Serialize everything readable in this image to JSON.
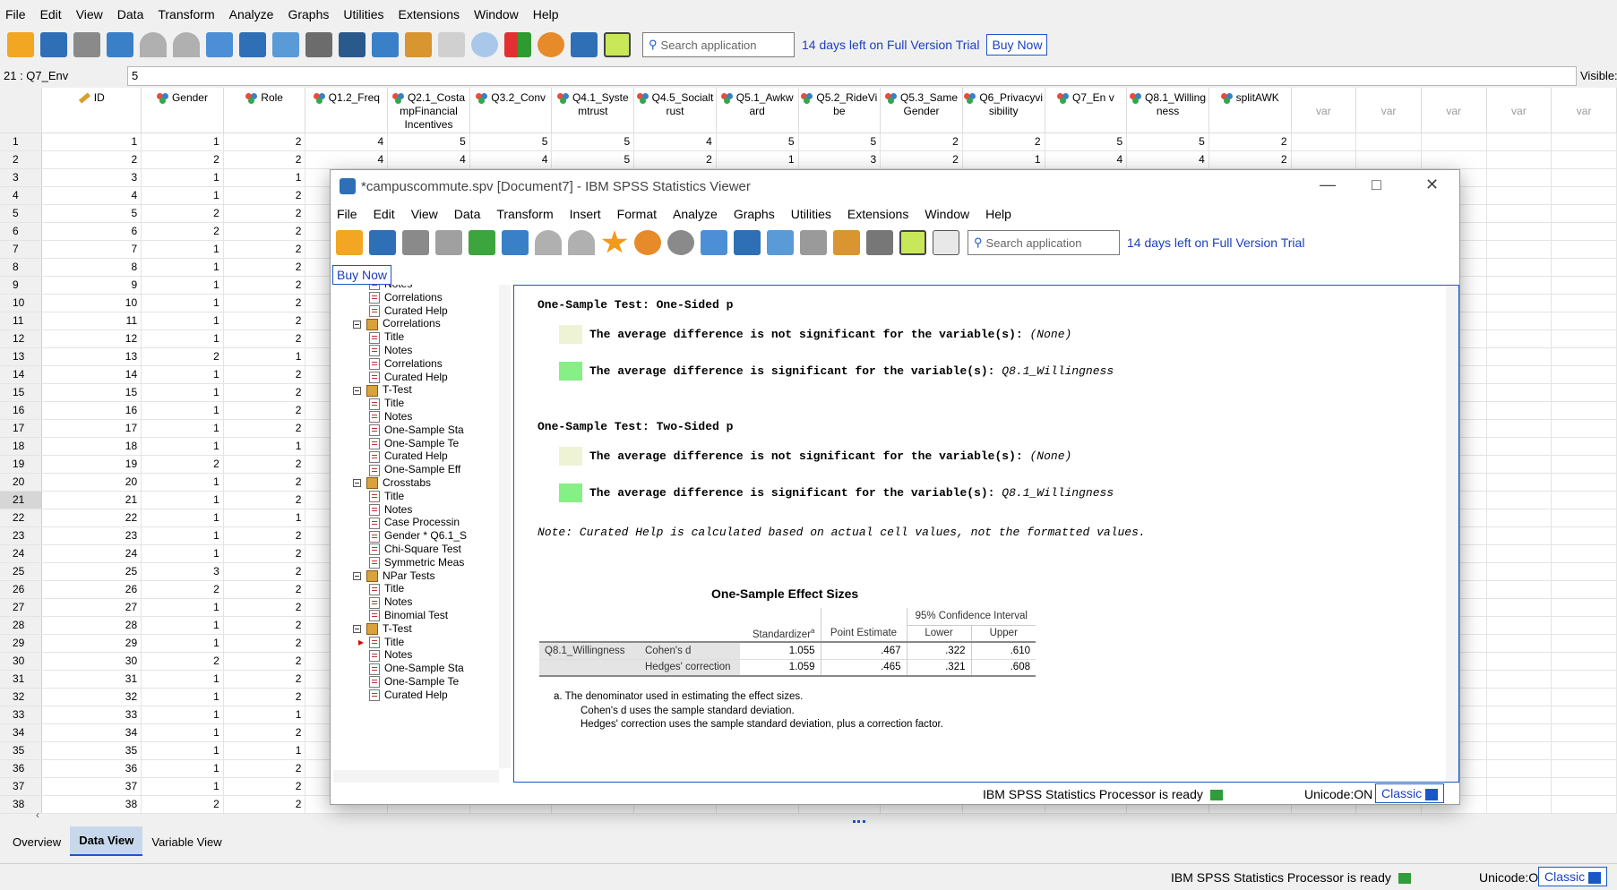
{
  "main_menu": [
    "File",
    "Edit",
    "View",
    "Data",
    "Transform",
    "Analyze",
    "Graphs",
    "Utilities",
    "Extensions",
    "Window",
    "Help"
  ],
  "search_placeholder": "Search application",
  "trial_text": "14 days left on Full Version Trial",
  "buy_label": "Buy Now",
  "cell_ref": "21 : Q7_Env",
  "cell_value": "5",
  "visible_label": "Visible:",
  "columns": [
    "ID",
    "Gender",
    "Role",
    "Q1.2_Freq",
    "Q2.1_Costa mpFinancial Incentives",
    "Q3.2_Conv",
    "Q4.1_Syste mtrust",
    "Q4.5_Socialt rust",
    "Q5.1_Awkw ard",
    "Q5.2_RideVi be",
    "Q5.3_Same Gender",
    "Q6_Privacyvi sibility",
    "Q7_En v",
    "Q8.1_Willing ness",
    "splitAWK"
  ],
  "var_columns": [
    "var",
    "var",
    "var",
    "var",
    "var"
  ],
  "row_values_full": [
    [
      "1",
      "1",
      "2",
      "4",
      "5",
      "5",
      "5",
      "4",
      "5",
      "5",
      "2",
      "2",
      "5",
      "5",
      "2"
    ],
    [
      "2",
      "2",
      "2",
      "4",
      "4",
      "4",
      "5",
      "2",
      "1",
      "3",
      "2",
      "1",
      "4",
      "4",
      "2"
    ]
  ],
  "row_values_left": [
    [
      "3",
      "1",
      "1"
    ],
    [
      "4",
      "1",
      "2"
    ],
    [
      "5",
      "2",
      "2"
    ],
    [
      "6",
      "2",
      "2"
    ],
    [
      "7",
      "1",
      "2"
    ],
    [
      "8",
      "1",
      "2"
    ],
    [
      "9",
      "1",
      "2"
    ],
    [
      "10",
      "1",
      "2"
    ],
    [
      "11",
      "1",
      "2"
    ],
    [
      "12",
      "1",
      "2"
    ],
    [
      "13",
      "2",
      "1"
    ],
    [
      "14",
      "1",
      "2"
    ],
    [
      "15",
      "1",
      "2"
    ],
    [
      "16",
      "1",
      "2"
    ],
    [
      "17",
      "1",
      "2"
    ],
    [
      "18",
      "1",
      "1"
    ],
    [
      "19",
      "2",
      "2"
    ],
    [
      "20",
      "1",
      "2"
    ],
    [
      "21",
      "1",
      "2"
    ],
    [
      "22",
      "1",
      "1"
    ],
    [
      "23",
      "1",
      "2"
    ],
    [
      "24",
      "1",
      "2"
    ],
    [
      "25",
      "3",
      "2"
    ],
    [
      "26",
      "2",
      "2"
    ],
    [
      "27",
      "1",
      "2"
    ],
    [
      "28",
      "1",
      "2"
    ],
    [
      "29",
      "1",
      "2"
    ],
    [
      "30",
      "2",
      "2"
    ],
    [
      "31",
      "1",
      "2"
    ],
    [
      "32",
      "1",
      "2"
    ],
    [
      "33",
      "1",
      "1"
    ],
    [
      "34",
      "1",
      "2"
    ],
    [
      "35",
      "1",
      "1"
    ],
    [
      "36",
      "1",
      "2"
    ],
    [
      "37",
      "1",
      "2"
    ],
    [
      "38",
      "2",
      "2"
    ]
  ],
  "row_numbers": [
    "1",
    "2",
    "3",
    "4",
    "5",
    "6",
    "7",
    "8",
    "9",
    "10",
    "11",
    "12",
    "13",
    "14",
    "15",
    "16",
    "17",
    "18",
    "19",
    "20",
    "21",
    "22",
    "23",
    "24",
    "25",
    "26",
    "27",
    "28",
    "29",
    "30",
    "31",
    "32",
    "33",
    "34",
    "35",
    "36",
    "37",
    "38"
  ],
  "bottom_tabs": [
    "Overview",
    "Data View",
    "Variable View"
  ],
  "status_ready": "IBM SPSS Statistics Processor is ready",
  "unicode": "Unicode:ON",
  "classic": "Classic",
  "viewer": {
    "title": "*campuscommute.spv [Document7] - IBM SPSS Statistics Viewer",
    "menu": [
      "File",
      "Edit",
      "View",
      "Data",
      "Transform",
      "Insert",
      "Format",
      "Analyze",
      "Graphs",
      "Utilities",
      "Extensions",
      "Window",
      "Help"
    ],
    "outline": [
      {
        "label": "Notes",
        "type": "page",
        "indent": 2,
        "partial": true
      },
      {
        "label": "Correlations",
        "type": "page",
        "indent": 2
      },
      {
        "label": "Curated Help",
        "type": "page",
        "indent": 2
      },
      {
        "label": "Correlations",
        "type": "book",
        "indent": 1
      },
      {
        "label": "Title",
        "type": "page",
        "indent": 2
      },
      {
        "label": "Notes",
        "type": "page",
        "indent": 2
      },
      {
        "label": "Correlations",
        "type": "page",
        "indent": 2
      },
      {
        "label": "Curated Help",
        "type": "page",
        "indent": 2
      },
      {
        "label": "T-Test",
        "type": "book",
        "indent": 1
      },
      {
        "label": "Title",
        "type": "page",
        "indent": 2
      },
      {
        "label": "Notes",
        "type": "page",
        "indent": 2
      },
      {
        "label": "One-Sample Sta",
        "type": "page",
        "indent": 2
      },
      {
        "label": "One-Sample Te",
        "type": "page",
        "indent": 2
      },
      {
        "label": "Curated Help",
        "type": "page",
        "indent": 2
      },
      {
        "label": "One-Sample Eff",
        "type": "page",
        "indent": 2
      },
      {
        "label": "Crosstabs",
        "type": "book",
        "indent": 1
      },
      {
        "label": "Title",
        "type": "page",
        "indent": 2
      },
      {
        "label": "Notes",
        "type": "page",
        "indent": 2
      },
      {
        "label": "Case Processin",
        "type": "page",
        "indent": 2
      },
      {
        "label": "Gender * Q6.1_S",
        "type": "page",
        "indent": 2
      },
      {
        "label": "Chi-Square Test",
        "type": "page",
        "indent": 2
      },
      {
        "label": "Symmetric Meas",
        "type": "page",
        "indent": 2
      },
      {
        "label": "NPar Tests",
        "type": "book",
        "indent": 1
      },
      {
        "label": "Title",
        "type": "page",
        "indent": 2
      },
      {
        "label": "Notes",
        "type": "page",
        "indent": 2
      },
      {
        "label": "Binomial Test",
        "type": "page",
        "indent": 2
      },
      {
        "label": "T-Test",
        "type": "book",
        "indent": 1
      },
      {
        "label": "Title",
        "type": "page",
        "indent": 2,
        "arrow": true
      },
      {
        "label": "Notes",
        "type": "page",
        "indent": 2
      },
      {
        "label": "One-Sample Sta",
        "type": "page",
        "indent": 2
      },
      {
        "label": "One-Sample Te",
        "type": "page",
        "indent": 2
      },
      {
        "label": "Curated Help",
        "type": "page",
        "indent": 2
      }
    ],
    "one_sided_heading": "One-Sample Test: One-Sided p",
    "two_sided_heading": "One-Sample Test: Two-Sided p",
    "not_sig_text": "The average difference is not significant for the variable(s):",
    "not_sig_vars": "(None)",
    "sig_text": "The average difference is significant for the variable(s):",
    "sig_vars": "Q8.1_Willingness",
    "note": "Note: Curated Help is calculated based on actual cell values, not the formatted values.",
    "colors": {
      "not_sig": "#eef3d6",
      "sig": "#86ef86"
    },
    "effect_table": {
      "title": "One-Sample Effect Sizes",
      "ci_header": "95% Confidence Interval",
      "headers": [
        "Standardizer",
        "Point Estimate",
        "Lower",
        "Upper"
      ],
      "superscript": "a",
      "variable": "Q8.1_Willingness",
      "rows": [
        {
          "label": "Cohen's d",
          "values": [
            "1.055",
            ".467",
            ".322",
            ".610"
          ]
        },
        {
          "label": "Hedges' correction",
          "values": [
            "1.059",
            ".465",
            ".321",
            ".608"
          ]
        }
      ],
      "footnotes": [
        "a. The denominator used in estimating the effect sizes.",
        "Cohen's d uses the sample standard deviation.",
        "Hedges' correction uses the sample standard deviation, plus a correction factor."
      ]
    }
  }
}
